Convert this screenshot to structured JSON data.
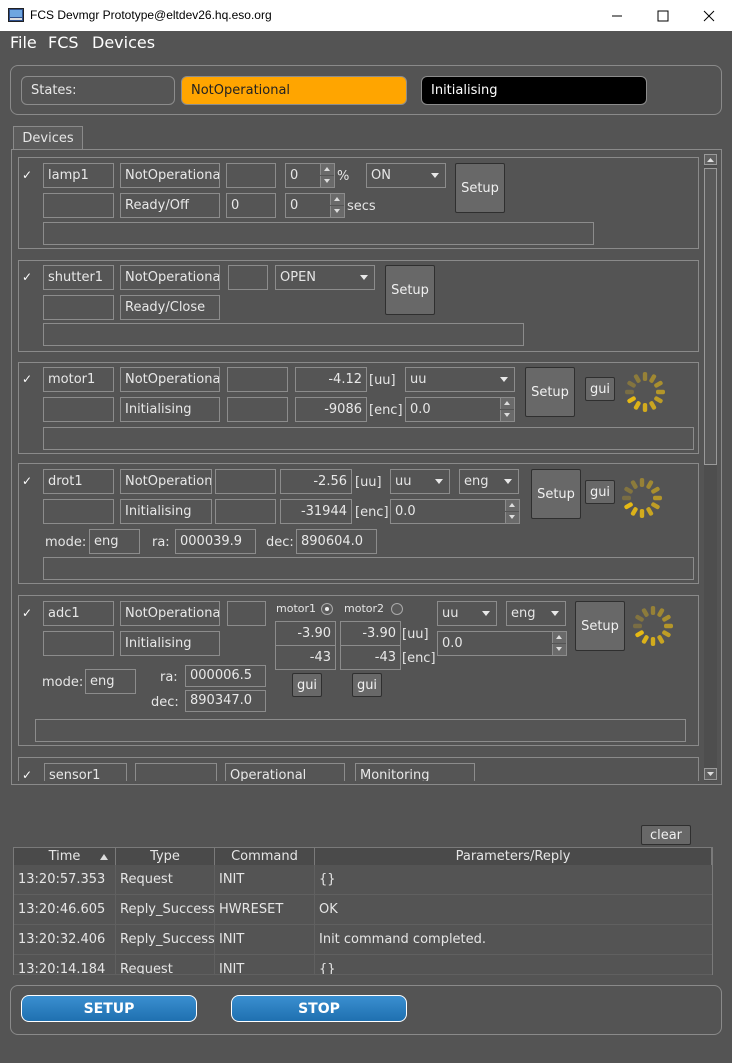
{
  "window": {
    "title": "FCS Devmgr Prototype@eltdev26.hq.eso.org"
  },
  "menu": [
    "File",
    "FCS",
    "Devices"
  ],
  "states": {
    "label": "States:",
    "primary": "NotOperational",
    "secondary": "Initialising",
    "primary_color": "#ffa500",
    "secondary_color": "#000000"
  },
  "tab": {
    "label": "Devices"
  },
  "devices": {
    "lamp1": {
      "name": "lamp1",
      "state": "NotOperational",
      "substate": "Ready/Off",
      "intensity": "0",
      "intensity_unit": "%",
      "time_value": "0",
      "time": "0",
      "time_unit": "secs",
      "onoff": "ON",
      "setup": "Setup"
    },
    "shutter1": {
      "name": "shutter1",
      "state": "NotOperational",
      "substate": "Ready/Close",
      "action": "OPEN",
      "setup": "Setup"
    },
    "motor1": {
      "name": "motor1",
      "state": "NotOperational",
      "substate": "Initialising",
      "pos_uu": "-4.12",
      "unit_uu": "[uu]",
      "pos_enc": "-9086",
      "unit_enc": "[enc]",
      "unit_select": "uu",
      "target": "0.0",
      "setup": "Setup",
      "gui": "gui"
    },
    "drot1": {
      "name": "drot1",
      "state": "NotOperational",
      "substate": "Initialising",
      "pos_uu": "-2.56",
      "unit_uu": "[uu]",
      "pos_enc": "-31944",
      "unit_enc": "[enc]",
      "unit_select": "uu",
      "mode_select": "eng",
      "target": "0.0",
      "mode_label": "mode:",
      "mode": "eng",
      "ra_label": "ra:",
      "ra": "000039.9",
      "dec_label": "dec:",
      "dec": "890604.0",
      "setup": "Setup",
      "gui": "gui"
    },
    "adc1": {
      "name": "adc1",
      "state": "NotOperational",
      "substate": "Initialising",
      "motor1_label": "motor1",
      "motor2_label": "motor2",
      "m1_uu": "-3.90",
      "m2_uu": "-3.90",
      "unit_uu": "[uu]",
      "m1_enc": "-43",
      "m2_enc": "-43",
      "unit_enc": "[enc]",
      "unit_select": "uu",
      "mode_select": "eng",
      "target": "0.0",
      "mode_label": "mode:",
      "mode": "eng",
      "ra_label": "ra:",
      "ra": "000006.5",
      "dec_label": "dec:",
      "dec": "890347.0",
      "setup": "Setup",
      "gui1": "gui",
      "gui2": "gui"
    },
    "sensor1": {
      "name": "sensor1",
      "state": "Operational",
      "substate": "Monitoring"
    }
  },
  "log": {
    "clear": "clear",
    "columns": [
      "Time",
      "Type",
      "Command",
      "Parameters/Reply"
    ],
    "rows": [
      {
        "time": "13:20:57.353",
        "type": "Request",
        "command": "INIT",
        "params": "{}"
      },
      {
        "time": "13:20:46.605",
        "type": "Reply_Success",
        "command": "HWRESET",
        "params": "OK"
      },
      {
        "time": "13:20:32.406",
        "type": "Reply_Success",
        "command": "INIT",
        "params": "Init command completed."
      },
      {
        "time": "13:20:14.184",
        "type": "Request",
        "command": "INIT",
        "params": "{}"
      }
    ]
  },
  "actions": {
    "setup": "SETUP",
    "stop": "STOP"
  }
}
